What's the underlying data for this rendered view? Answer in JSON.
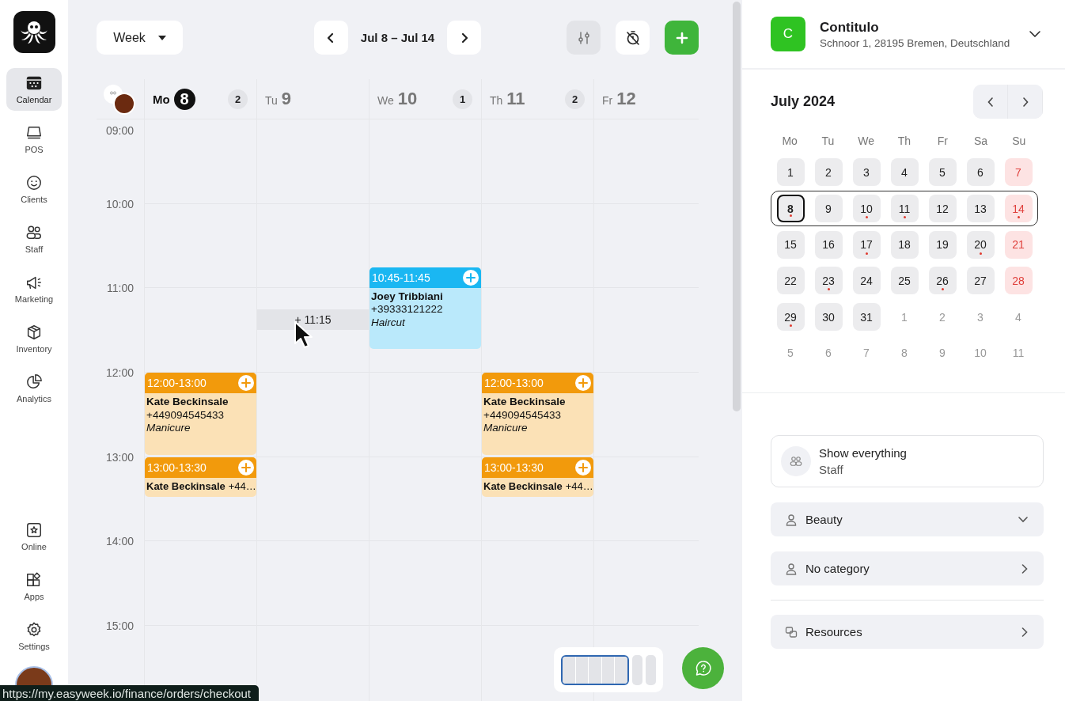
{
  "sidebar": {
    "items": [
      {
        "label": "Calendar",
        "selected": true
      },
      {
        "label": "POS",
        "selected": false
      },
      {
        "label": "Clients",
        "selected": false
      },
      {
        "label": "Staff",
        "selected": false
      },
      {
        "label": "Marketing",
        "selected": false
      },
      {
        "label": "Inventory",
        "selected": false
      },
      {
        "label": "Analytics",
        "selected": false
      }
    ],
    "bottom_items": [
      {
        "label": "Online",
        "selected": false
      },
      {
        "label": "Apps",
        "selected": false
      },
      {
        "label": "Settings",
        "selected": false
      }
    ]
  },
  "toolbar": {
    "view": "Week",
    "date_range": "Jul 8 – Jul 14"
  },
  "hours": [
    "09:00",
    "10:00",
    "11:00",
    "12:00",
    "13:00",
    "14:00",
    "15:00"
  ],
  "days": [
    {
      "weekday": "Mo",
      "date": "8",
      "selected": true,
      "count": "2",
      "events": [
        {
          "kind": "full",
          "color": "#f29a0c",
          "time": "12:00-13:00",
          "name": "Kate Beckinsale",
          "phone": "+449094545433",
          "service": "Manicure"
        },
        {
          "kind": "compact",
          "color": "#f29a0c",
          "time": "13:00-13:30",
          "name": "Kate Beckinsale",
          "phone": "+44…"
        }
      ]
    },
    {
      "weekday": "Tu",
      "date": "9",
      "selected": false,
      "hover_slot": "+ 11:15"
    },
    {
      "weekday": "We",
      "date": "10",
      "selected": false,
      "count": "1",
      "events": [
        {
          "kind": "full",
          "color": "#1ab7f2",
          "time": "10:45-11:45",
          "name": "Joey Tribbiani",
          "phone": "+39333121222",
          "service": "Haircut"
        }
      ]
    },
    {
      "weekday": "Th",
      "date": "11",
      "selected": false,
      "count": "2",
      "events": [
        {
          "kind": "full",
          "color": "#f29a0c",
          "time": "12:00-13:00",
          "name": "Kate Beckinsale",
          "phone": "+449094545433",
          "service": "Manicure"
        },
        {
          "kind": "compact",
          "color": "#f29a0c",
          "time": "13:00-13:30",
          "name": "Kate Beckinsale",
          "phone": "+44…"
        }
      ]
    },
    {
      "weekday": "Fr",
      "date": "12",
      "selected": false
    }
  ],
  "status_url": "https://my.easyweek.io/finance/orders/checkout",
  "business": {
    "initial": "C",
    "name": "Contitulo",
    "address": "Schnoor 1, 28195 Bremen, Deutschland"
  },
  "mini_calendar": {
    "title": "July 2024",
    "weekdays": [
      "Mo",
      "Tu",
      "We",
      "Th",
      "Fr",
      "Sa",
      "Su"
    ],
    "weeks": [
      {
        "selected": false,
        "days": [
          {
            "label": "1",
            "kind": "day",
            "dot": false,
            "selected": false
          },
          {
            "label": "2",
            "kind": "day",
            "dot": false,
            "selected": false
          },
          {
            "label": "3",
            "kind": "day",
            "dot": false,
            "selected": false
          },
          {
            "label": "4",
            "kind": "day",
            "dot": false,
            "selected": false
          },
          {
            "label": "5",
            "kind": "day",
            "dot": false,
            "selected": false
          },
          {
            "label": "6",
            "kind": "day",
            "dot": false,
            "selected": false
          },
          {
            "label": "7",
            "kind": "weekend",
            "dot": false,
            "selected": false
          }
        ]
      },
      {
        "selected": true,
        "days": [
          {
            "label": "8",
            "kind": "day",
            "dot": true,
            "selected": true
          },
          {
            "label": "9",
            "kind": "day",
            "dot": false,
            "selected": false
          },
          {
            "label": "10",
            "kind": "day",
            "dot": true,
            "selected": false
          },
          {
            "label": "11",
            "kind": "day",
            "dot": true,
            "selected": false
          },
          {
            "label": "12",
            "kind": "day",
            "dot": false,
            "selected": false
          },
          {
            "label": "13",
            "kind": "day",
            "dot": false,
            "selected": false
          },
          {
            "label": "14",
            "kind": "weekend",
            "dot": true,
            "selected": false
          }
        ]
      },
      {
        "selected": false,
        "days": [
          {
            "label": "15",
            "kind": "day",
            "dot": false,
            "selected": false
          },
          {
            "label": "16",
            "kind": "day",
            "dot": false,
            "selected": false
          },
          {
            "label": "17",
            "kind": "day",
            "dot": true,
            "selected": false
          },
          {
            "label": "18",
            "kind": "day",
            "dot": false,
            "selected": false
          },
          {
            "label": "19",
            "kind": "day",
            "dot": false,
            "selected": false
          },
          {
            "label": "20",
            "kind": "day",
            "dot": true,
            "selected": false
          },
          {
            "label": "21",
            "kind": "weekend",
            "dot": false,
            "selected": false
          }
        ]
      },
      {
        "selected": false,
        "days": [
          {
            "label": "22",
            "kind": "day",
            "dot": false,
            "selected": false
          },
          {
            "label": "23",
            "kind": "day",
            "dot": true,
            "selected": false
          },
          {
            "label": "24",
            "kind": "day",
            "dot": false,
            "selected": false
          },
          {
            "label": "25",
            "kind": "day",
            "dot": false,
            "selected": false
          },
          {
            "label": "26",
            "kind": "day",
            "dot": true,
            "selected": false
          },
          {
            "label": "27",
            "kind": "day",
            "dot": false,
            "selected": false
          },
          {
            "label": "28",
            "kind": "weekend",
            "dot": false,
            "selected": false
          }
        ]
      },
      {
        "selected": false,
        "days": [
          {
            "label": "29",
            "kind": "day",
            "dot": true,
            "selected": false
          },
          {
            "label": "30",
            "kind": "day",
            "dot": false,
            "selected": false
          },
          {
            "label": "31",
            "kind": "day",
            "dot": false,
            "selected": false
          },
          {
            "label": "1",
            "kind": "other_month",
            "dot": false,
            "selected": false
          },
          {
            "label": "2",
            "kind": "other_month",
            "dot": false,
            "selected": false
          },
          {
            "label": "3",
            "kind": "other_month",
            "dot": false,
            "selected": false
          },
          {
            "label": "4",
            "kind": "other_month",
            "dot": false,
            "selected": false
          }
        ]
      },
      {
        "selected": false,
        "days": [
          {
            "label": "5",
            "kind": "other_month",
            "dot": false,
            "selected": false
          },
          {
            "label": "6",
            "kind": "other_month",
            "dot": false,
            "selected": false
          },
          {
            "label": "7",
            "kind": "other_month",
            "dot": false,
            "selected": false
          },
          {
            "label": "8",
            "kind": "other_month",
            "dot": false,
            "selected": false
          },
          {
            "label": "9",
            "kind": "other_month",
            "dot": false,
            "selected": false
          },
          {
            "label": "10",
            "kind": "other_month",
            "dot": false,
            "selected": false
          },
          {
            "label": "11",
            "kind": "other_month",
            "dot": false,
            "selected": false
          }
        ]
      }
    ]
  },
  "filters": {
    "staff": {
      "title": "Show everything",
      "subtitle": "Staff"
    },
    "groups": [
      {
        "label": "Beauty",
        "expanded": true
      },
      {
        "label": "No category",
        "expanded": false
      }
    ],
    "resources": {
      "label": "Resources"
    }
  }
}
